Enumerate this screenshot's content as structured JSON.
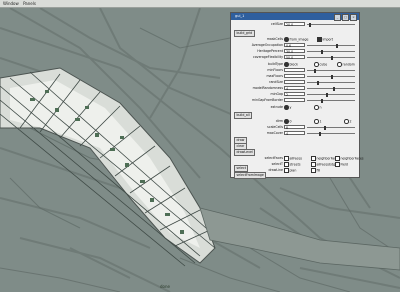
{
  "menu": [
    "Window",
    "Panels"
  ],
  "status": "done",
  "panel": {
    "title": "gui_1",
    "cell_size": {
      "label": "cellSize",
      "value": "20.0",
      "slider": 0.05
    },
    "build_grid_button": "build_grid",
    "mask_cells": {
      "label": "maskCells",
      "options": [
        "from_image",
        "import"
      ],
      "selected": 0,
      "checked": 1
    },
    "rows": [
      {
        "label": "AverageOccupation",
        "value": "0.6",
        "slider": 0.6
      },
      {
        "label": "HeritagePercent",
        "value": "30.0",
        "slider": 0.3
      },
      {
        "label": "coverageFlexibility",
        "value": "50.0",
        "slider": 0.5
      }
    ],
    "build_type": {
      "label": "buildType",
      "options": [
        "block",
        "cube",
        "random"
      ],
      "selected": 0
    },
    "type_rows": [
      {
        "label": "minFloors",
        "value": "",
        "slider": 0.15
      },
      {
        "label": "maxFloors",
        "value": "",
        "slider": 0.5
      },
      {
        "label": "randSize",
        "value": "",
        "slider": 0.2
      },
      {
        "label": "modelRandomness",
        "value": "4",
        "slider": 0.55
      },
      {
        "label": "minGap",
        "value": "2",
        "slider": 0.4
      },
      {
        "label": "minGapFromBorder",
        "value": "",
        "slider": 0.3
      }
    ],
    "extrude": {
      "label": "extrude",
      "options": [
        "y",
        "n"
      ],
      "selected": 0
    },
    "build_button": "build_all",
    "dir": {
      "label": "dirm",
      "options": [
        "0",
        "1",
        "2"
      ],
      "selected": 0
    },
    "dir_rows": [
      {
        "label": "scaleCells",
        "value": "8",
        "slider": 0.35
      },
      {
        "label": "maxCover",
        "value": "4",
        "slider": 0.25
      }
    ],
    "side_buttons": [
      "draw",
      "clear",
      "drawLevel"
    ],
    "select_faces": {
      "label": "selectFaces",
      "items": [
        "allFaces",
        "neighborFaces",
        "neighborFaces",
        "streets",
        "allFacesEdges",
        "Field",
        "plan",
        "fill"
      ]
    },
    "labels_extra": [
      "selectT",
      "drawLine"
    ],
    "bottom_buttons": [
      "select",
      "selectFromImage"
    ]
  }
}
